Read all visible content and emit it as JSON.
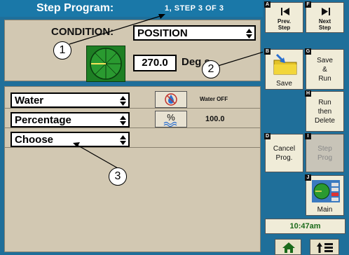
{
  "header": {
    "title": "Step Program:",
    "step_info": "1, STEP  3  OF  3"
  },
  "condition": {
    "label": "CONDITION:",
    "value": "POSITION",
    "degrees_value": "270.0",
    "degrees_unit": "Deg   s"
  },
  "parameters": [
    {
      "select_value": "Water",
      "button_icon": "water-drop-icon",
      "status_text": "Water OFF"
    },
    {
      "select_value": "Percentage",
      "button_icon": "percent-icon",
      "status_text": "100.0"
    },
    {
      "select_value": "Choose"
    }
  ],
  "callouts": [
    "1",
    "2",
    "3"
  ],
  "sidebar": {
    "prev_step": {
      "key": "A",
      "label_line1": "Prev.",
      "label_line2": "Step"
    },
    "next_step": {
      "key": "F",
      "label_line1": "Next",
      "label_line2": "Step"
    },
    "save": {
      "key": "B",
      "label": "Save"
    },
    "save_run": {
      "key": "G",
      "label_line1": "Save",
      "label_line2": "&",
      "label_line3": "Run"
    },
    "run_then_delete": {
      "key": "H",
      "label_line1": "Run",
      "label_line2": "then",
      "label_line3": "Delete"
    },
    "cancel_prog": {
      "key": "D",
      "label_line1": "Cancel",
      "label_line2": "Prog."
    },
    "step_prog": {
      "key": "I",
      "label_line1": "Step",
      "label_line2": "Prog"
    },
    "main": {
      "key": "J",
      "label": "Main"
    },
    "clock": "10:47am"
  },
  "colors": {
    "accent_blue": "#1f6f9a",
    "panel_tan": "#d2c8b2",
    "gauge_green": "#1e7f24",
    "clock_green": "#1a6a1a"
  }
}
